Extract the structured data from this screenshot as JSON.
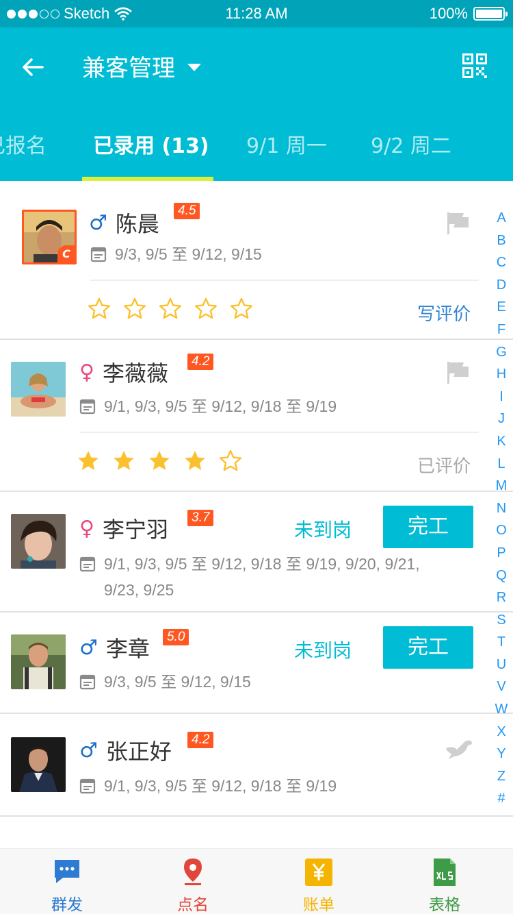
{
  "status_bar": {
    "carrier": "Sketch",
    "time": "11:28 AM",
    "battery": "100%"
  },
  "header": {
    "title": "兼客管理"
  },
  "tabs": [
    {
      "label": "已报名"
    },
    {
      "label": "已录用 (13)"
    },
    {
      "label": "9/1 周一"
    },
    {
      "label": "9/2 周二"
    }
  ],
  "workers": [
    {
      "name": "陈晨",
      "gender": "♂",
      "score": "4.5",
      "dates": "9/3, 9/5 至 9/12, 9/15",
      "action": "写评价",
      "rating": 0
    },
    {
      "name": "李薇薇",
      "gender": "♀",
      "score": "4.2",
      "dates": "9/1, 9/3, 9/5 至 9/12, 9/18 至 9/19",
      "action": "已评价",
      "rating": 4
    },
    {
      "name": "李宁羽",
      "gender": "♀",
      "score": "3.7",
      "dates_line1": "9/1, 9/3, 9/5 至 9/12, 9/18 至 9/19, 9/20, 9/21,",
      "dates_line2": "9/23, 9/25",
      "status": "未到岗",
      "button": "完工"
    },
    {
      "name": "李章",
      "gender": "♂",
      "score": "5.0",
      "dates": "9/3, 9/5 至 9/12, 9/15",
      "status": "未到岗",
      "button": "完工"
    },
    {
      "name": "张正好",
      "gender": "♂",
      "score": "4.2",
      "dates": "9/1, 9/3, 9/5 至 9/12, 9/18 至 9/19"
    }
  ],
  "alphabet": [
    "A",
    "B",
    "C",
    "D",
    "E",
    "F",
    "G",
    "H",
    "I",
    "J",
    "K",
    "L",
    "M",
    "N",
    "O",
    "P",
    "Q",
    "R",
    "S",
    "T",
    "U",
    "V",
    "W",
    "X",
    "Y",
    "Z",
    "#"
  ],
  "bottom_nav": [
    {
      "label": "群发",
      "icon": "message-icon",
      "color": "#2d7bd2"
    },
    {
      "label": "点名",
      "icon": "location-pin-icon",
      "color": "#e0463a"
    },
    {
      "label": "账单",
      "icon": "yen-icon",
      "color": "#f5b400"
    },
    {
      "label": "表格",
      "icon": "xls-icon",
      "color": "#3e9b47"
    }
  ],
  "colors": {
    "primary": "#00bcd4",
    "accent": "#dcf03a",
    "score_badge": "#ff5722",
    "star": "#fbc02d"
  },
  "avatar_badge": "C"
}
